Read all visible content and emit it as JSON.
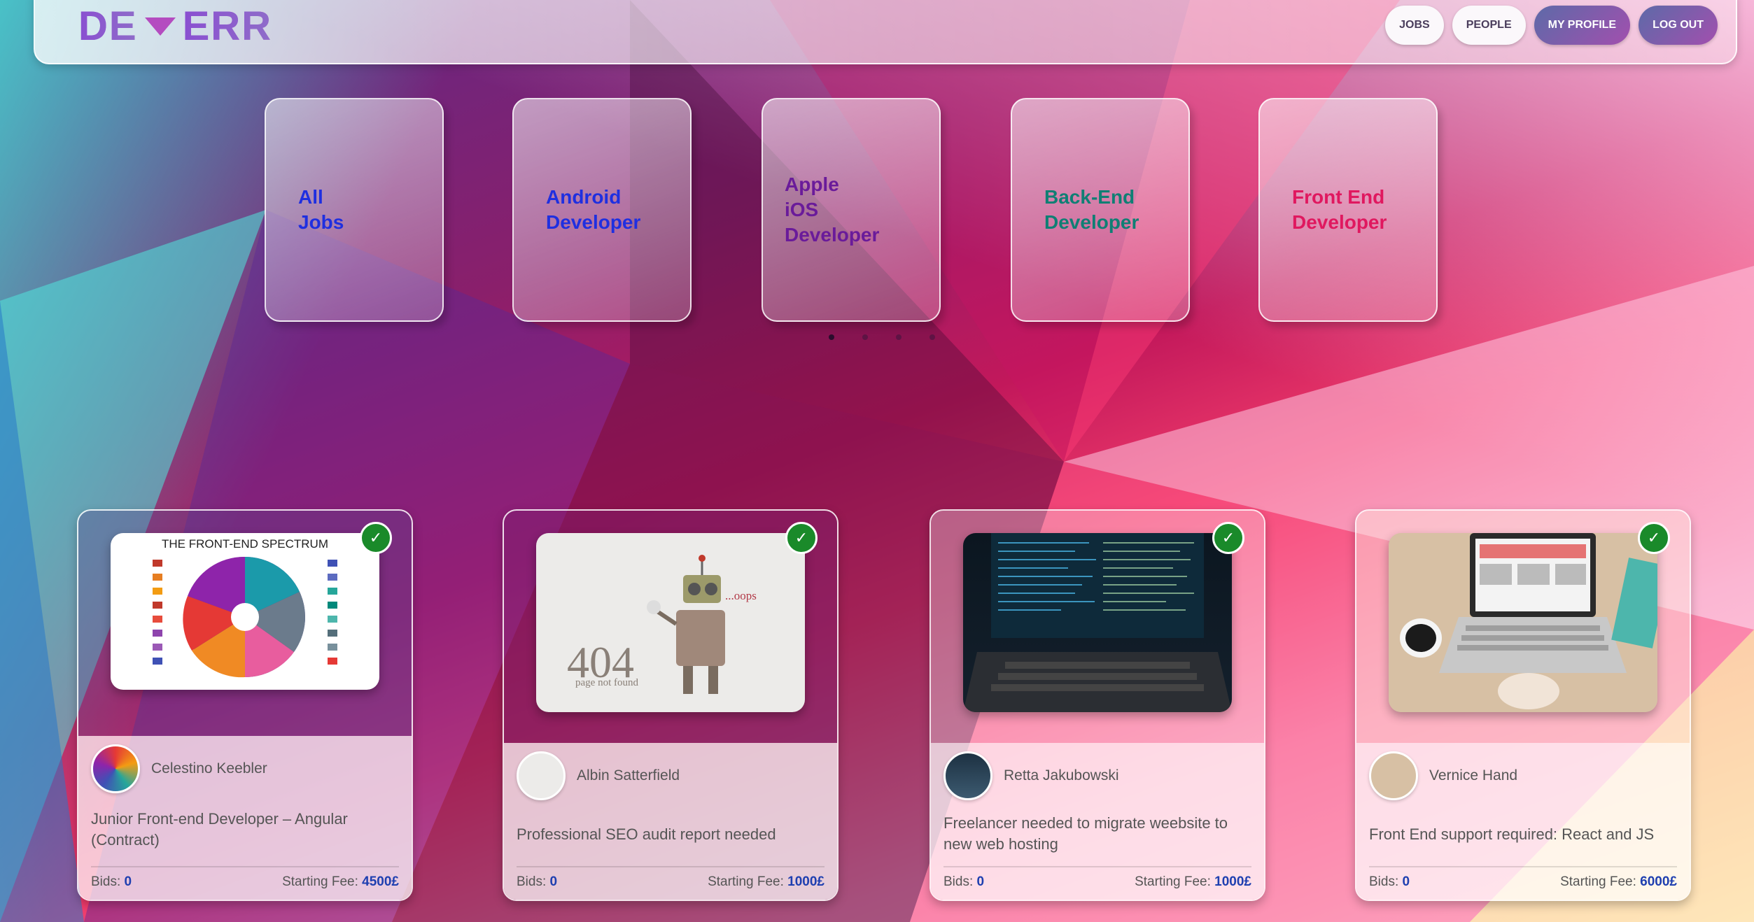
{
  "brand": {
    "logo_left": "DE",
    "logo_right": "ERR"
  },
  "nav": {
    "buttons": [
      "JOBS",
      "PEOPLE",
      "MY PROFILE",
      "LOG OUT"
    ]
  },
  "categories": [
    {
      "line1": "All",
      "line2": "Jobs",
      "color": "#1f2fe0"
    },
    {
      "line1": "Android",
      "line2": "Developer",
      "color": "#1f2fe0"
    },
    {
      "line1": "Apple",
      "line2": "iOS Developer",
      "color": "#6a1b9a"
    },
    {
      "line1": "Back-End",
      "line2": "Developer",
      "color": "#0f7f74"
    },
    {
      "line1": "Front End",
      "line2": "Developer",
      "color": "#e0185f"
    }
  ],
  "carousel": {
    "page_count": 4,
    "active_index": 0
  },
  "jobs": [
    {
      "image_title": "THE FRONT-END SPECTRUM",
      "poster": "Celestino Keebler",
      "title": "Junior Front-end Developer – Angular (Contract)",
      "bids_label": "Bids:",
      "bids": "0",
      "fee_label": "Starting Fee:",
      "fee": "4500£"
    },
    {
      "image_title": "404",
      "image_subtitle": "page not found",
      "image_oops": "...oops",
      "poster": "Albin Satterfield",
      "title": "Professional SEO audit report needed",
      "bids_label": "Bids:",
      "bids": "0",
      "fee_label": "Starting Fee:",
      "fee": "1000£"
    },
    {
      "poster": "Retta Jakubowski",
      "title": "Freelancer needed to migrate weebsite to new web hosting",
      "bids_label": "Bids:",
      "bids": "0",
      "fee_label": "Starting Fee:",
      "fee": "1000£"
    },
    {
      "poster": "Vernice Hand",
      "title": "Front End support required: React and JS",
      "bids_label": "Bids:",
      "bids": "0",
      "fee_label": "Starting Fee:",
      "fee": "6000£"
    }
  ]
}
